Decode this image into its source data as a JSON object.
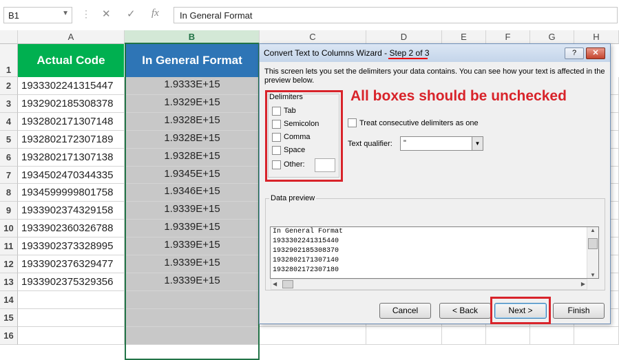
{
  "formula_bar": {
    "name_box": "B1",
    "cancel_icon": "✕",
    "enter_icon": "✓",
    "fx_icon": "fx",
    "formula": "In General Format"
  },
  "columns": [
    "A",
    "B",
    "C",
    "D",
    "E",
    "F",
    "G",
    "H"
  ],
  "rows": [
    "1",
    "2",
    "3",
    "4",
    "5",
    "6",
    "7",
    "8",
    "9",
    "10",
    "11",
    "12",
    "13",
    "14",
    "15",
    "16"
  ],
  "sheet": {
    "header_a": "Actual Code",
    "header_b": "In General Format",
    "col_a": [
      "1933302241315447",
      "1932902185308378",
      "1932802171307148",
      "1932802172307189",
      "1932802171307138",
      "1934502470344335",
      "1934599999801758",
      "1933902374329158",
      "1933902360326788",
      "1933902373328995",
      "1933902376329477",
      "1933902375329356"
    ],
    "col_b": [
      "1.9333E+15",
      "1.9329E+15",
      "1.9328E+15",
      "1.9328E+15",
      "1.9328E+15",
      "1.9345E+15",
      "1.9346E+15",
      "1.9339E+15",
      "1.9339E+15",
      "1.9339E+15",
      "1.9339E+15",
      "1.9339E+15"
    ],
    "colors": {
      "header_a_bg": "#00b050",
      "header_b_bg": "#2e75b6",
      "selection": "#217346"
    }
  },
  "dialog": {
    "title": "Convert Text to Columns Wizard - ",
    "step": "Step 2 of 3",
    "help_label": "?",
    "close_label": "✕",
    "description": "This screen lets you set the delimiters your data contains.  You can see how your text is affected in the preview below.",
    "delimiters_label": "Delimiters",
    "delimiters": [
      {
        "label": "Tab",
        "checked": false
      },
      {
        "label": "Semicolon",
        "checked": false
      },
      {
        "label": "Comma",
        "checked": false
      },
      {
        "label": "Space",
        "checked": false
      },
      {
        "label": "Other:",
        "checked": false
      }
    ],
    "annotation": "All boxes should be unchecked",
    "consecutive_label": "Treat consecutive delimiters as one",
    "text_qualifier_label": "Text qualifier:",
    "text_qualifier_value": "\"",
    "preview_label": "Data preview",
    "preview_lines": [
      "In General Format",
      "1933302241315440",
      "1932902185308370",
      "1932802171307140",
      "1932802172307180"
    ],
    "buttons": {
      "cancel": "Cancel",
      "back": "< Back",
      "next": "Next >",
      "finish": "Finish"
    },
    "annotation_color": "#d8232a"
  }
}
